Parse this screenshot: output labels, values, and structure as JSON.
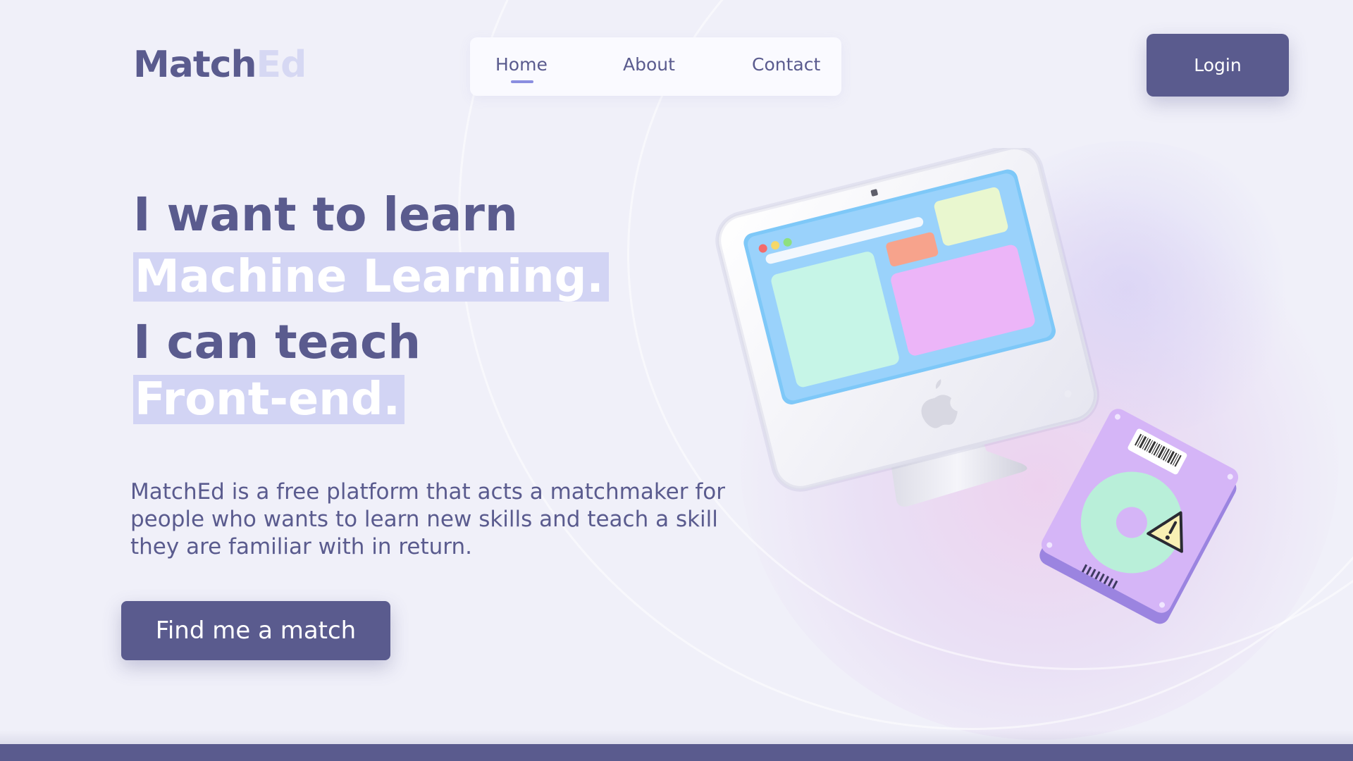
{
  "brand": {
    "name_primary": "Match",
    "name_accent": "Ed",
    "color_primary": "#5a5b8e",
    "color_accent": "#d6d8f3"
  },
  "nav": {
    "items": [
      {
        "label": "Home",
        "active": true
      },
      {
        "label": "About",
        "active": false
      },
      {
        "label": "Contact",
        "active": false
      }
    ]
  },
  "login_label": "Login",
  "hero": {
    "line1": "I want to learn",
    "line2": "Machine Learning.",
    "line3": "I can teach",
    "line4": "Front-end.",
    "highlight_color": "#d2d4f4"
  },
  "description": "MatchEd is a free platform that acts a matchmaker for people who wants to learn new skills and teach a skill they are familiar with in return.",
  "cta_label": "Find me a match",
  "illustrations": {
    "computer": "computer-illustration-icon",
    "disk": "hard-disk-warning-icon"
  }
}
